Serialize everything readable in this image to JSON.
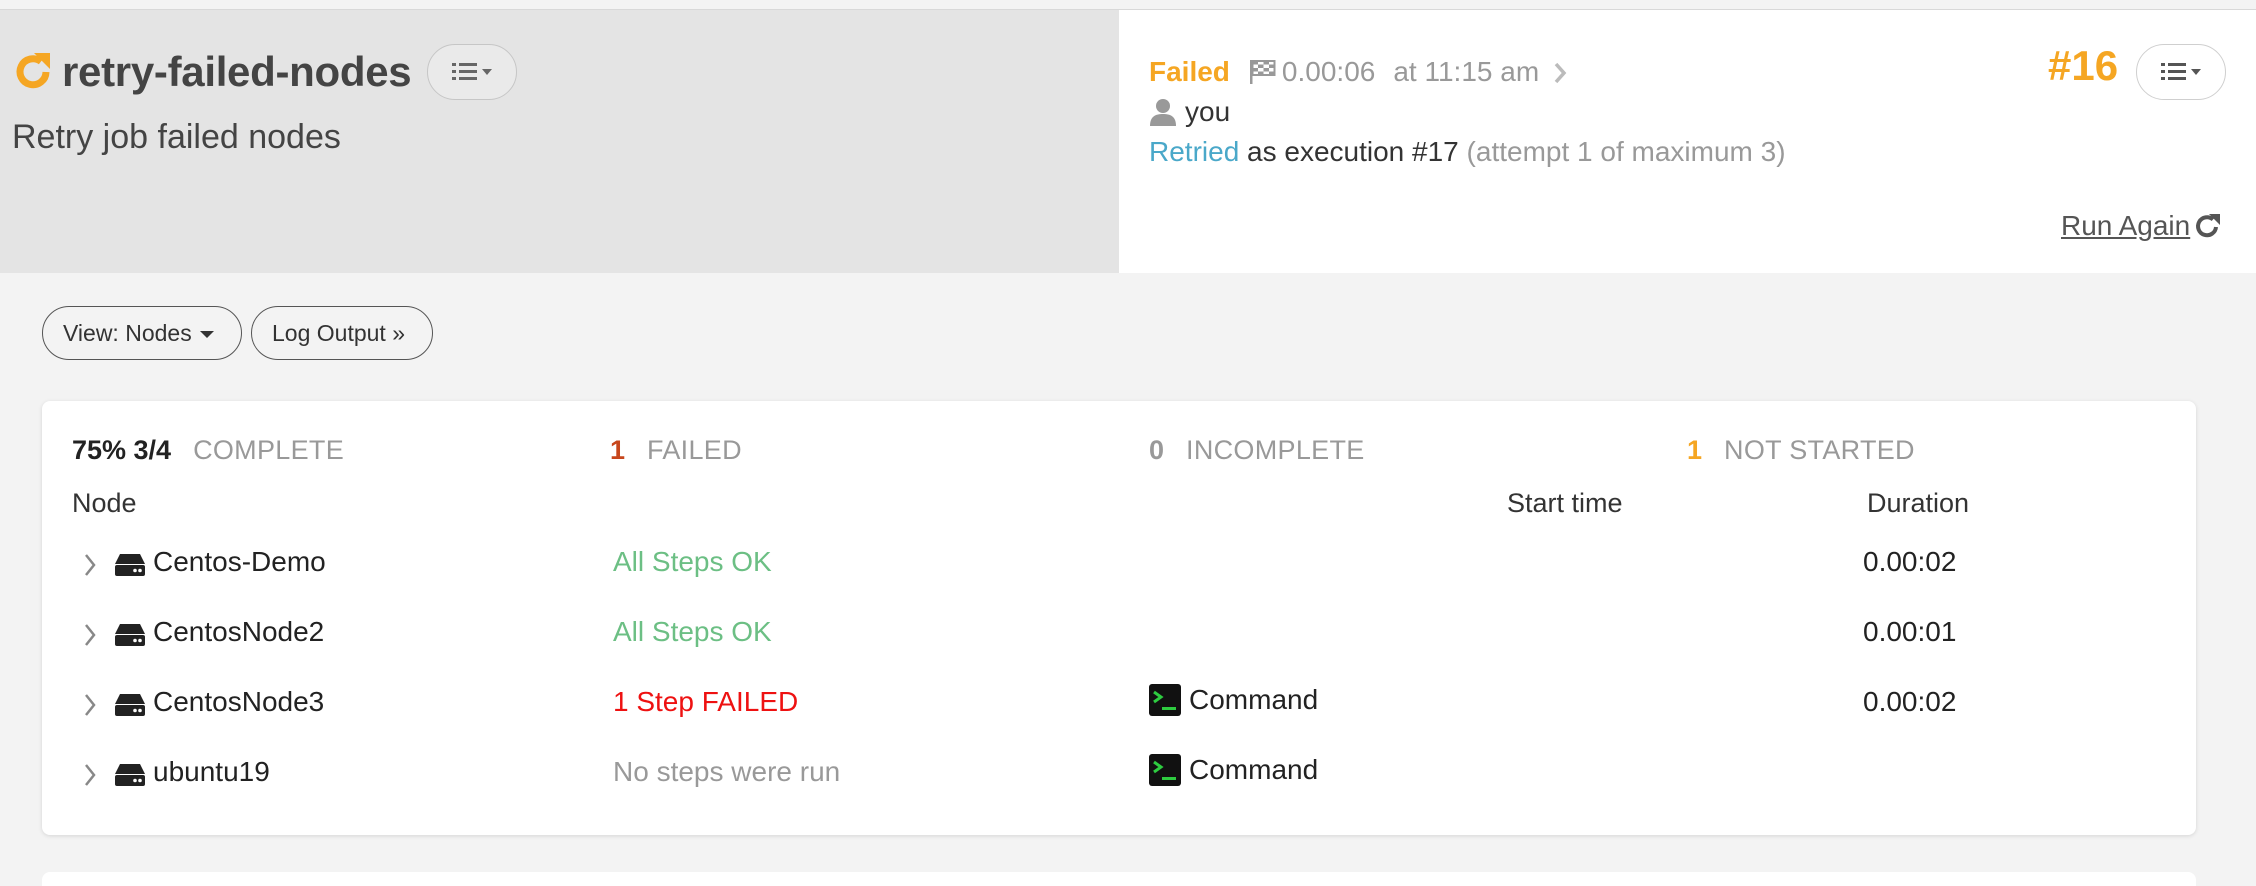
{
  "header": {
    "job_name": "retry-failed-nodes",
    "job_description": "Retry job failed nodes",
    "status": "Failed",
    "duration": "0.00:06",
    "time": "at 11:15 am",
    "user": "you",
    "retried_link": "Retried",
    "retried_text": " as execution #17 ",
    "attempt_text": "(attempt 1 of maximum 3)",
    "execution_number": "#16",
    "run_again": "Run Again"
  },
  "toolbar": {
    "view_label": "View: Nodes",
    "log_output_label": "Log Output »"
  },
  "summary": {
    "complete_pct": "75% 3/4",
    "complete_label": "COMPLETE",
    "failed_count": "1",
    "failed_label": "FAILED",
    "incomplete_count": "0",
    "incomplete_label": "INCOMPLETE",
    "not_started_count": "1",
    "not_started_label": "NOT STARTED"
  },
  "table": {
    "headers": {
      "node": "Node",
      "start_time": "Start time",
      "duration": "Duration"
    },
    "rows": [
      {
        "node": "Centos-Demo",
        "status": "All Steps OK",
        "step": "",
        "duration": "0.00:02"
      },
      {
        "node": "CentosNode2",
        "status": "All Steps OK",
        "step": "",
        "duration": "0.00:01"
      },
      {
        "node": "CentosNode3",
        "status": "1 Step FAILED",
        "step": "Command",
        "duration": "0.00:02"
      },
      {
        "node": "ubuntu19",
        "status": "No steps were run",
        "step": "Command",
        "duration": ""
      }
    ]
  },
  "colors": {
    "status_failed": "#f5a623",
    "ok": "#6cbf84",
    "error": "#ee1111",
    "link": "#4aa8c9"
  }
}
